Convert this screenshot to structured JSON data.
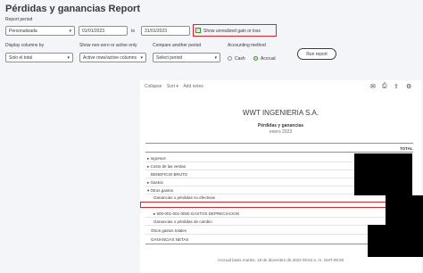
{
  "page_title": "Pérdidas y ganancias Report",
  "filters": {
    "report_period_label": "Report period",
    "report_period_value": "Personalizada",
    "date_from": "01/01/2023",
    "to_label": "to",
    "date_to": "31/01/2023",
    "unrealized_label": "Show unrealized gain or loss",
    "display_columns_label": "Display columns by",
    "display_columns_value": "Solo el total",
    "show_nonzero_label": "Show non-zero or active only",
    "show_nonzero_value": "Active rows/active columns",
    "compare_label": "Compare another period",
    "compare_value": "Select period",
    "accounting_label": "Accounting method",
    "cash_label": "Cash",
    "accrual_label": "Accrual",
    "run_button": "Run report"
  },
  "toolbar": {
    "collapse": "Collapse",
    "sort": "Sort",
    "add_notes": "Add notes"
  },
  "report": {
    "company": "WWT INGENIERIA S.A.",
    "title": "Pérdidas y ganancias",
    "period": "enero 2023",
    "total_header": "TOTAL",
    "rows": [
      {
        "label": "▸ Ingresos",
        "indent": 0
      },
      {
        "label": "▸ Costo de las ventas",
        "indent": 0
      },
      {
        "label": "BENEFICIO BRUTO",
        "indent": 0
      },
      {
        "label": "▸ Gastos",
        "indent": 0
      },
      {
        "label": "▾ Otros gastos",
        "indent": 0
      },
      {
        "label": "Ganancias o pérdidas no efectivas",
        "indent": 1
      },
      {
        "label": "▸ 500-001-001-0000 GASTOS DEPRECIACION",
        "indent": 1
      },
      {
        "label": "Ganancias o pérdidas de cambio",
        "indent": 1
      },
      {
        "label": "Otros gastos totales",
        "indent": 0
      },
      {
        "label": "GANANCIAS NETAS",
        "indent": 0
      }
    ],
    "footer": "Accrual basis  martes, 19 de diciembre de 2023  09:53 a. m. GMT-06:00"
  }
}
